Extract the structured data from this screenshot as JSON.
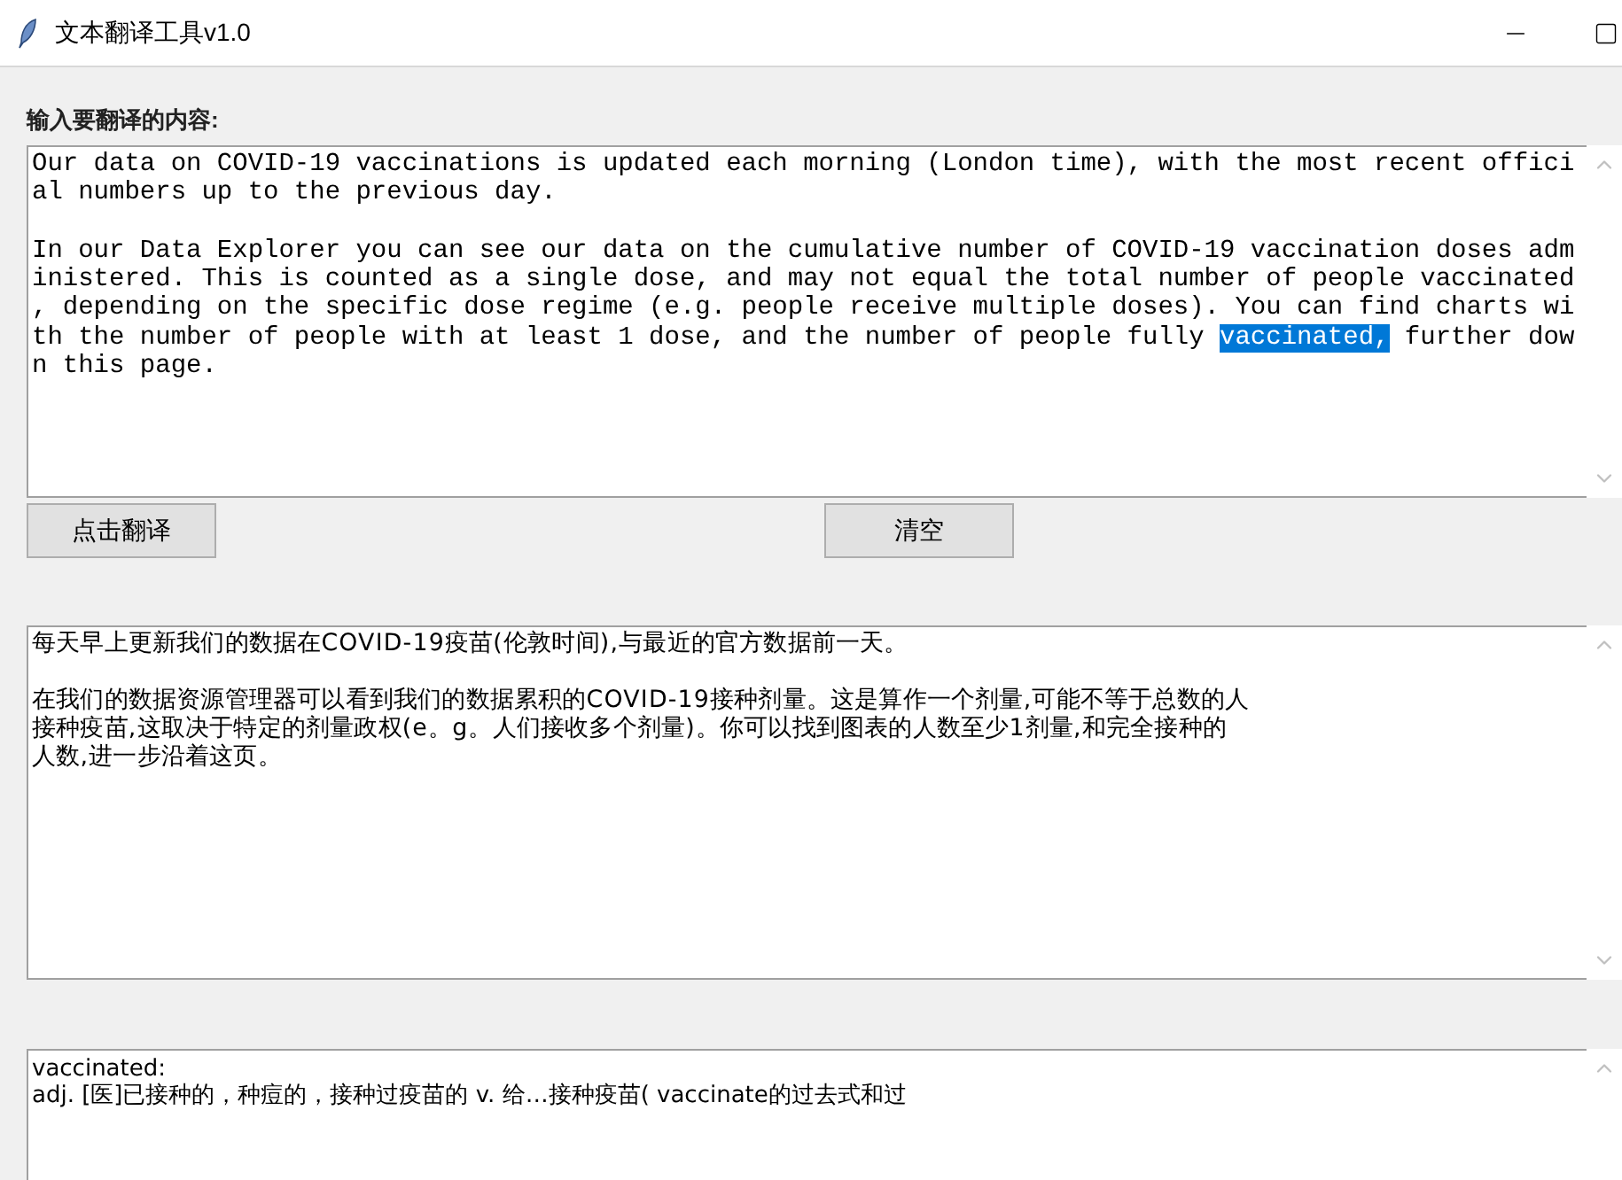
{
  "window": {
    "title": "文本翻译工具v1.0"
  },
  "input_label": "输入要翻译的内容:",
  "input_text": {
    "paragraphs": [
      [
        [
          {
            "text": "Our data on COVID-19 vaccinations is updated each morning (London time), with the most recent offici",
            "selected": false
          }
        ],
        [
          {
            "text": "al numbers up to the previous day.",
            "selected": false
          }
        ]
      ],
      [
        [
          {
            "text": "In our Data Explorer you can see our data on the cumulative number of COVID-19 vaccination doses adm",
            "selected": false
          }
        ],
        [
          {
            "text": "inistered. This is counted as a single dose, and may not equal the total number of people vaccinated",
            "selected": false
          }
        ],
        [
          {
            "text": ", depending on the specific dose regime (e.g. people receive multiple doses). You can find charts wi",
            "selected": false
          }
        ],
        [
          {
            "text": "th the number of people with at least 1 dose, and the number of people fully ",
            "selected": false
          },
          {
            "text": "vaccinated,",
            "selected": true
          },
          {
            "text": " further dow",
            "selected": false
          }
        ],
        [
          {
            "text": "n this page.",
            "selected": false
          }
        ]
      ]
    ]
  },
  "buttons": [
    {
      "label": "点击翻译"
    },
    {
      "label": "清空"
    }
  ],
  "translation_text": {
    "paragraphs": [
      [
        "每天早上更新我们的数据在COVID-19疫苗(伦敦时间),与最近的官方数据前一天。"
      ],
      [
        "在我们的数据资源管理器可以看到我们的数据累积的COVID-19接种剂量。这是算作一个剂量,可能不等于总数的人",
        "接种疫苗,这取决于特定的剂量政权(e。g。人们接收多个剂量)。你可以找到图表的人数至少1剂量,和完全接种的",
        "人数,进一步沿着这页。"
      ]
    ]
  },
  "lookup_text": {
    "lines": [
      "vaccinated:",
      "adj. [医]已接种的，种痘的，接种过疫苗的 v. 给…接种疫苗( vaccinate的过去式和过"
    ]
  }
}
